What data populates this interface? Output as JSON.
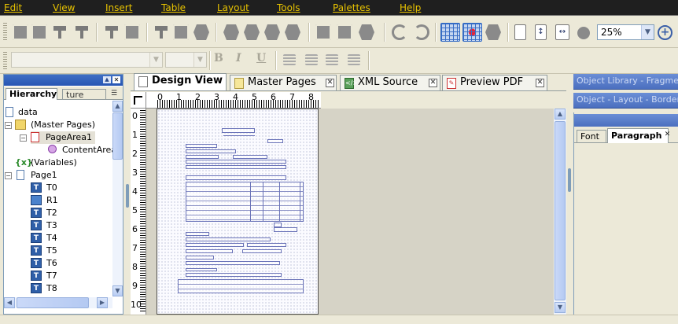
{
  "menu": {
    "items": [
      "Edit",
      "View",
      "Insert",
      "Table",
      "Layout",
      "Tools",
      "Palettes",
      "Help"
    ]
  },
  "toolbar": {
    "zoom_value": "25%",
    "zoom_in_icon": "zoom-in-icon"
  },
  "format_toolbar": {
    "bold": "B",
    "italic": "I",
    "underline": "U"
  },
  "left_panel": {
    "tabs": [
      "Hierarchy",
      "ture"
    ],
    "tree": [
      {
        "label": "data",
        "icon": "page-icon"
      },
      {
        "label": "(Master Pages)",
        "icon": "folder-icon"
      },
      {
        "label": "PageArea1",
        "icon": "page-area-icon"
      },
      {
        "label": "ContentArea",
        "icon": "content-area-icon"
      },
      {
        "label": "(Variables)",
        "icon": "variables-icon"
      },
      {
        "label": "Page1",
        "icon": "page-icon"
      },
      {
        "label": "T0",
        "icon": "text-field-icon"
      },
      {
        "label": "R1",
        "icon": "rectangle-icon"
      },
      {
        "label": "T2",
        "icon": "text-field-icon"
      },
      {
        "label": "T3",
        "icon": "text-field-icon"
      },
      {
        "label": "T4",
        "icon": "text-field-icon"
      },
      {
        "label": "T5",
        "icon": "text-field-icon"
      },
      {
        "label": "T6",
        "icon": "text-field-icon"
      },
      {
        "label": "T7",
        "icon": "text-field-icon"
      },
      {
        "label": "T8",
        "icon": "text-field-icon"
      }
    ]
  },
  "editor_tabs": [
    {
      "label": "Design View",
      "active": true
    },
    {
      "label": "Master Pages",
      "active": false
    },
    {
      "label": "XML Source",
      "active": false
    },
    {
      "label": "Preview PDF",
      "active": false
    }
  ],
  "rulers": {
    "horizontal": [
      "0",
      "1",
      "2",
      "3",
      "4",
      "5",
      "6",
      "7",
      "8"
    ],
    "vertical": [
      "0",
      "1",
      "2",
      "3",
      "4",
      "5",
      "6",
      "7",
      "8",
      "9",
      "10"
    ]
  },
  "right_panels": {
    "object_library": "Object Library - Fragment L",
    "object_layout": "Object - Layout - Border - A",
    "tabs": [
      "Font",
      "Paragraph"
    ]
  },
  "colors": {
    "menu_bg": "#1f1f1f",
    "menu_text": "#e8c300",
    "panel_title": "#4b6fbf",
    "canvas_bg": "#d6d3c6"
  }
}
